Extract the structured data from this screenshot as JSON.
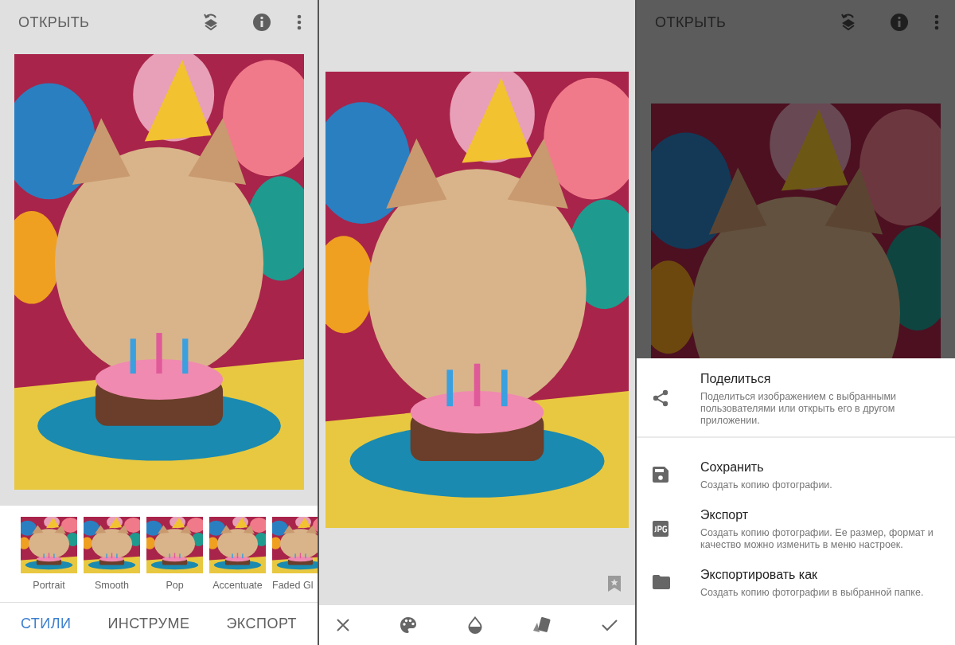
{
  "left_screen": {
    "top_bar": {
      "title": "ОТКРЫТЬ",
      "dimmed": false
    },
    "styles": [
      {
        "label": "Portrait"
      },
      {
        "label": "Smooth"
      },
      {
        "label": "Pop"
      },
      {
        "label": "Accentuate"
      },
      {
        "label": "Faded Gl"
      }
    ],
    "tabs": [
      {
        "label": "СТИЛИ",
        "selected": true
      },
      {
        "label": "ИНСТРУМЕ",
        "selected": false
      },
      {
        "label": "ЭКСПОРТ",
        "selected": false
      }
    ]
  },
  "right_screen": {
    "top_bar": {
      "title": "ОТКРЫТЬ",
      "dimmed": true
    },
    "share_menu": [
      {
        "kind": "share",
        "title": "Поделиться",
        "description": "Поделиться изображением с выбранными пользователями или открыть его в другом приложении."
      },
      {
        "kind": "save",
        "title": "Сохранить",
        "description": "Создать копию фотографии."
      },
      {
        "kind": "jpg",
        "title": "Экспорт",
        "description": "Создать копию фотографии. Ее размер, формат и качество можно изменить в меню настроек."
      },
      {
        "kind": "folder",
        "title": "Экспортировать как",
        "description": "Создать копию фотографии в выбранной папке."
      }
    ]
  }
}
